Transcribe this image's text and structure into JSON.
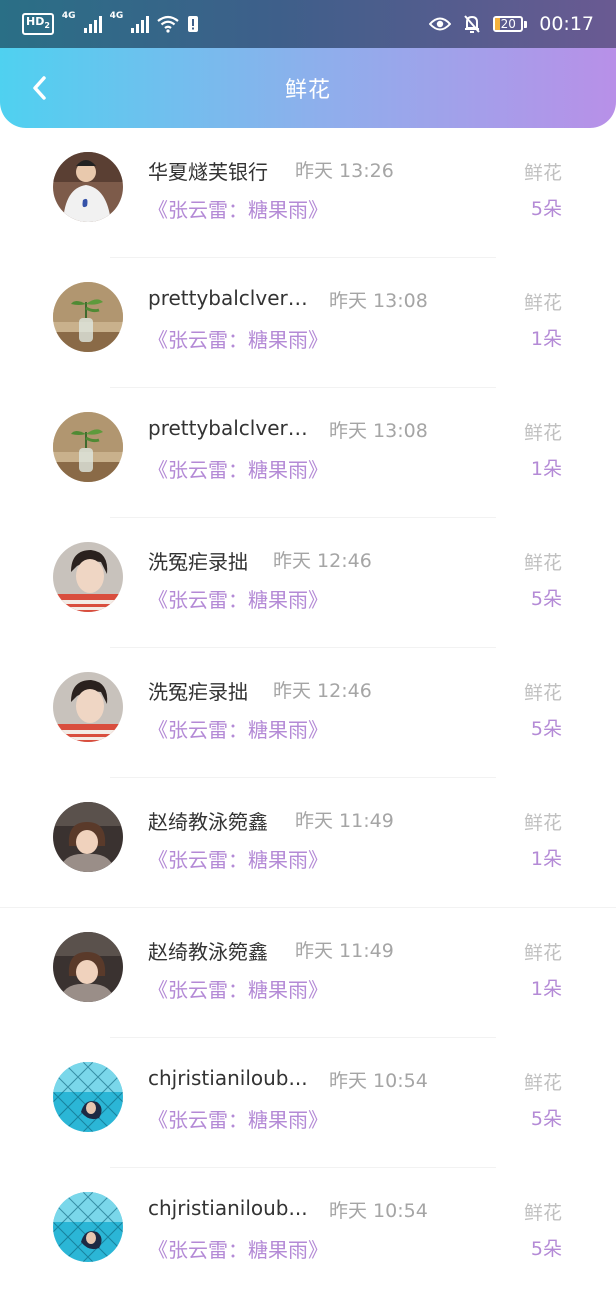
{
  "status_bar": {
    "hd_label": "HD",
    "hd_sub": "2",
    "network_1": "4G",
    "network_2": "4G",
    "battery": "20",
    "time": "00:17"
  },
  "header": {
    "title": "鲜花"
  },
  "records": [
    {
      "name": "华夏燧芙银行",
      "time": "昨天 13:26",
      "song": "《张云雷：糖果雨》",
      "gift": "鲜花",
      "count": "5朵",
      "avatar": "avatar-man-white-shirt"
    },
    {
      "name": "prettybalclverin...",
      "time": "昨天 13:08",
      "song": "《张云雷：糖果雨》",
      "gift": "鲜花",
      "count": "1朵",
      "avatar": "avatar-plant-bottle"
    },
    {
      "name": "prettybalclverin...",
      "time": "昨天 13:08",
      "song": "《张云雷：糖果雨》",
      "gift": "鲜花",
      "count": "1朵",
      "avatar": "avatar-plant-bottle"
    },
    {
      "name": "洗冤疟录拙",
      "time": "昨天 12:46",
      "song": "《张云雷：糖果雨》",
      "gift": "鲜花",
      "count": "5朵",
      "avatar": "avatar-man-portrait"
    },
    {
      "name": "洗冤疟录拙",
      "time": "昨天 12:46",
      "song": "《张云雷：糖果雨》",
      "gift": "鲜花",
      "count": "5朵",
      "avatar": "avatar-man-portrait"
    },
    {
      "name": "赵绮教泳箢鑫",
      "time": "昨天 11:49",
      "song": "《张云雷：糖果雨》",
      "gift": "鲜花",
      "count": "1朵",
      "avatar": "avatar-girl-dark"
    },
    {
      "name": "赵绮教泳箢鑫",
      "time": "昨天 11:49",
      "song": "《张云雷：糖果雨》",
      "gift": "鲜花",
      "count": "1朵",
      "avatar": "avatar-girl-dark"
    },
    {
      "name": "chjristianiloub...",
      "time": "昨天 10:54",
      "song": "《张云雷：糖果雨》",
      "gift": "鲜花",
      "count": "5朵",
      "avatar": "avatar-girl-fence-blue"
    },
    {
      "name": "chjristianiloub...",
      "time": "昨天 10:54",
      "song": "《张云雷：糖果雨》",
      "gift": "鲜花",
      "count": "5朵",
      "avatar": "avatar-girl-fence-blue"
    }
  ]
}
